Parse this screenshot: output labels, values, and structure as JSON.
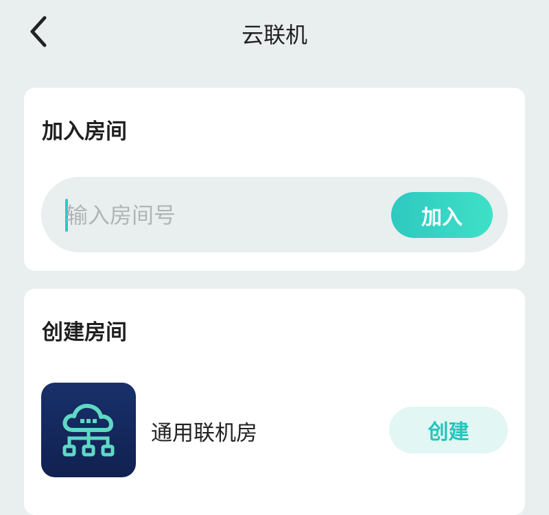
{
  "header": {
    "title": "云联机",
    "back_icon": "chevron-left-icon"
  },
  "join_room": {
    "title": "加入房间",
    "input_placeholder": "输入房间号",
    "input_value": "",
    "join_label": "加入"
  },
  "create_room": {
    "title": "创建房间",
    "rooms": [
      {
        "name": "通用联机房",
        "icon": "cloud-network-icon",
        "create_label": "创建"
      }
    ]
  },
  "colors": {
    "background": "#e9eeee",
    "card": "#ffffff",
    "accent": "#2ec9c0",
    "create_button_bg": "#e2f6f4",
    "app_icon_bg": "#18306b"
  }
}
